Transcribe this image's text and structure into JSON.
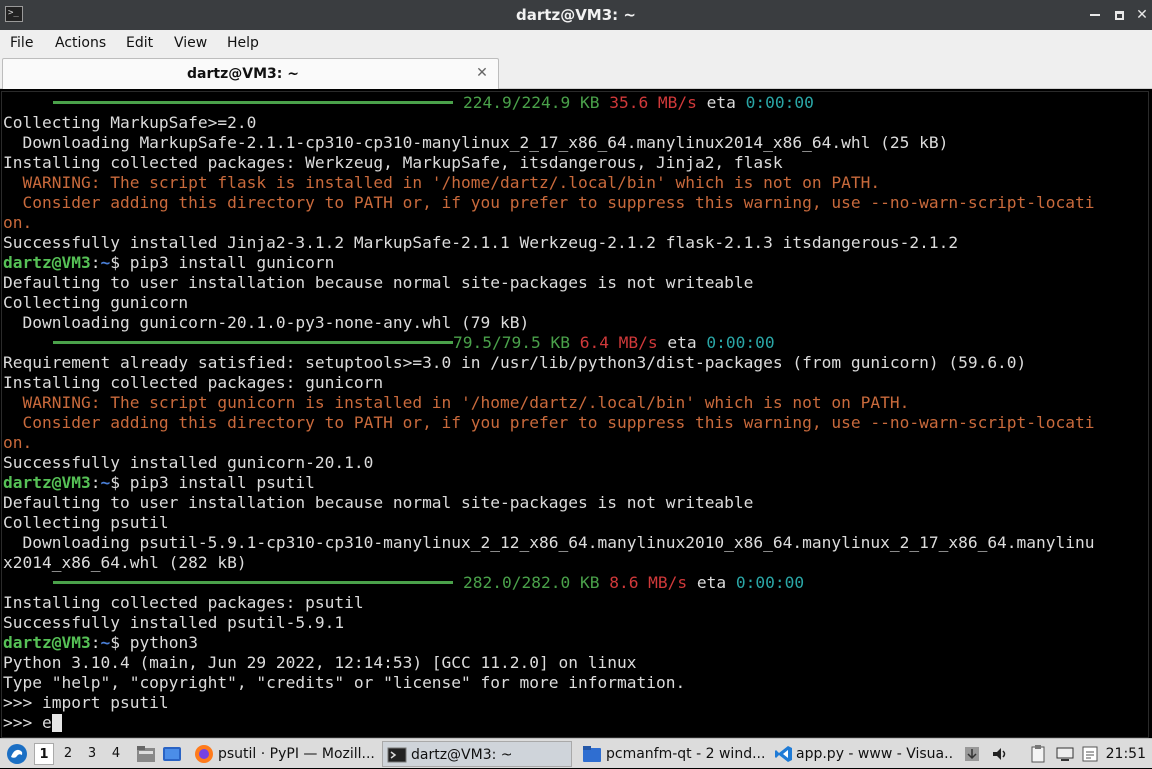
{
  "window": {
    "title": "dartz@VM3: ~",
    "app_icon_glyph": ">_",
    "minimize_icon": "minimize-icon",
    "maximize_icon": "maximize-icon",
    "close_glyph": "✕"
  },
  "menubar": {
    "items": [
      "File",
      "Actions",
      "Edit",
      "View",
      "Help"
    ]
  },
  "tab": {
    "label": "dartz@VM3: ~",
    "close_glyph": "✕"
  },
  "terminal": {
    "prompt_user": "dartz@VM3",
    "prompt_colon": ":",
    "prompt_dir": "~",
    "prompt_sign": "$ ",
    "progress1": {
      "size": "224.9/224.9 KB",
      "speed": "35.6 MB/s",
      "eta_label": "eta",
      "eta": "0:00:00"
    },
    "line_collecting_markupsafe": "Collecting MarkupSafe>=2.0",
    "line_download_markupsafe": "  Downloading MarkupSafe-2.1.1-cp310-cp310-manylinux_2_17_x86_64.manylinux2014_x86_64.whl (25 kB)",
    "line_installing_flask": "Installing collected packages: Werkzeug, MarkupSafe, itsdangerous, Jinja2, flask",
    "warn_flask_1": "  WARNING: The script flask is installed in '/home/dartz/.local/bin' which is not on PATH.",
    "warn_flask_2": "  Consider adding this directory to PATH or, if you prefer to suppress this warning, use --no-warn-script-locati",
    "warn_flask_3": "on.",
    "line_success_flask": "Successfully installed Jinja2-3.1.2 MarkupSafe-2.1.1 Werkzeug-2.1.2 flask-2.1.3 itsdangerous-2.1.2",
    "cmd_gunicorn": "pip3 install gunicorn",
    "line_default_1": "Defaulting to user installation because normal site-packages is not writeable",
    "line_collecting_gunicorn": "Collecting gunicorn",
    "line_download_gunicorn": "  Downloading gunicorn-20.1.0-py3-none-any.whl (79 kB)",
    "progress2": {
      "size": "79.5/79.5 KB",
      "speed": "6.4 MB/s",
      "eta_label": "eta",
      "eta": "0:00:00"
    },
    "line_requirement": "Requirement already satisfied: setuptools>=3.0 in /usr/lib/python3/dist-packages (from gunicorn) (59.6.0)",
    "line_installing_gunicorn": "Installing collected packages: gunicorn",
    "warn_gunicorn_1": "  WARNING: The script gunicorn is installed in '/home/dartz/.local/bin' which is not on PATH.",
    "warn_gunicorn_2": "  Consider adding this directory to PATH or, if you prefer to suppress this warning, use --no-warn-script-locati",
    "warn_gunicorn_3": "on.",
    "line_success_gunicorn": "Successfully installed gunicorn-20.1.0",
    "cmd_psutil": "pip3 install psutil",
    "line_default_2": "Defaulting to user installation because normal site-packages is not writeable",
    "line_collecting_psutil": "Collecting psutil",
    "line_download_psutil_1": "  Downloading psutil-5.9.1-cp310-cp310-manylinux_2_12_x86_64.manylinux2010_x86_64.manylinux_2_17_x86_64.manylinu",
    "line_download_psutil_2": "x2014_x86_64.whl (282 kB)",
    "progress3": {
      "size": "282.0/282.0 KB",
      "speed": "8.6 MB/s",
      "eta_label": "eta",
      "eta": "0:00:00"
    },
    "line_installing_psutil": "Installing collected packages: psutil",
    "line_success_psutil": "Successfully installed psutil-5.9.1",
    "cmd_python": "python3",
    "line_python_version": "Python 3.10.4 (main, Jun 29 2022, 12:14:53) [GCC 11.2.0] on linux",
    "line_python_help": "Type \"help\", \"copyright\", \"credits\" or \"license\" for more information.",
    "line_repl_import": ">>> import psutil",
    "repl_prompt": ">>> ",
    "repl_input": "e"
  },
  "taskbar": {
    "start_icon": "start-menu-icon",
    "workspaces": [
      "1",
      "2",
      "3",
      "4"
    ],
    "active_workspace": "1",
    "tasks": [
      {
        "label": "psutil · PyPI — Mozill...",
        "icon": "firefox-icon"
      },
      {
        "label": "dartz@VM3: ~",
        "icon": "terminal-icon"
      },
      {
        "label": "pcmanfm-qt - 2 wind...",
        "icon": "folder-icon"
      },
      {
        "label": "app.py - www - Visua...",
        "icon": "vscode-icon"
      }
    ],
    "tray_icons": [
      "update-icon",
      "volume-icon",
      "clipboard-icon",
      "network-icon",
      "notes-icon"
    ],
    "clock": "21:51"
  },
  "colors": {
    "titlebar": "#3a3d40",
    "terminal_bg": "#000000",
    "prompt_green": "#56c156",
    "prompt_blue": "#4a7fd6",
    "warning_orange": "#c96a3c",
    "progress_green": "#4aa14a",
    "speed_red": "#d0393a",
    "eta_cyan": "#2aa6a6"
  }
}
